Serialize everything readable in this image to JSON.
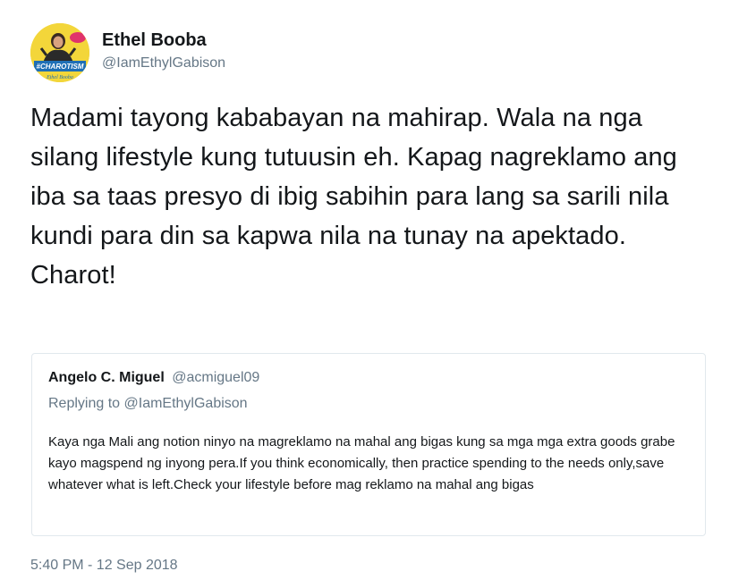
{
  "author": {
    "display_name": "Ethel Booba",
    "handle": "@IamEthylGabison",
    "avatar_text": "#CHAROTISM",
    "avatar_signature": "Ethel Booba",
    "avatar_bubble": "CHARO"
  },
  "tweet": {
    "text": "Madami tayong kababayan na mahirap. Wala na nga silang lifestyle kung tutuusin eh. Kapag nagreklamo ang iba sa taas presyo di ibig sabihin para lang sa sarili nila kundi para din sa kapwa nila na tunay na apektado. Charot!",
    "timestamp": "5:40 PM - 12 Sep 2018"
  },
  "quoted_tweet": {
    "display_name": "Angelo C. Miguel",
    "handle": "@acmiguel09",
    "replying_prefix": "Replying to",
    "replying_to": "@IamEthylGabison",
    "text": "Kaya nga Mali ang notion ninyo na magreklamo na mahal ang bigas kung sa mga mga extra goods grabe kayo magspend ng inyong pera.If you think economically, then practice spending to the needs only,save whatever what is left.Check your lifestyle before mag reklamo na mahal ang bigas"
  },
  "colors": {
    "text_primary": "#14171a",
    "text_secondary": "#657786",
    "border": "#e1e8ed",
    "avatar_bg": "#f3d63a"
  }
}
